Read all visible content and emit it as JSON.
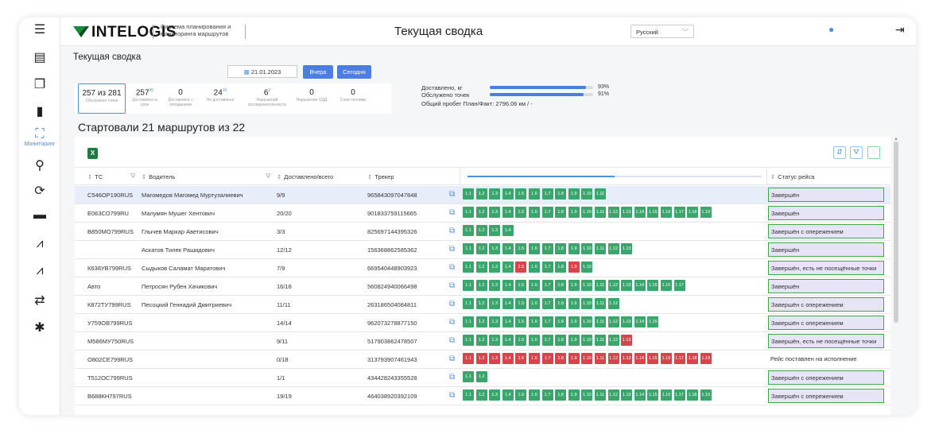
{
  "sidebar": {
    "items": [
      {
        "name": "menu-icon",
        "glyph": "☰"
      },
      {
        "name": "clipboard-icon",
        "glyph": "▤"
      },
      {
        "name": "documents-icon",
        "glyph": "❐"
      },
      {
        "name": "document-icon",
        "glyph": "▮"
      },
      {
        "name": "monitoring-icon",
        "glyph": "⛶",
        "label": "Мониторинг"
      },
      {
        "name": "routes-icon",
        "glyph": "⚲"
      },
      {
        "name": "sync-icon",
        "glyph": "⟳"
      },
      {
        "name": "folder-icon",
        "glyph": "▬"
      },
      {
        "name": "chart-icon",
        "glyph": "⩘"
      },
      {
        "name": "chart2-icon",
        "glyph": "⩘"
      },
      {
        "name": "transfer-icon",
        "glyph": "⇄"
      },
      {
        "name": "settings-icon",
        "glyph": "✱"
      }
    ]
  },
  "header": {
    "logo": "INTELOGIS",
    "logo_subtitle": "Система планирования и мониторинга маршрутов",
    "title": "Текущая сводка",
    "language": "Русский",
    "user_icon": "user-icon",
    "logout_icon": "logout-icon"
  },
  "summary": {
    "title": "Текущая сводка",
    "date": "21.01.2023",
    "btn_yesterday": "Вчера",
    "btn_today": "Сегодня",
    "stats": [
      {
        "value": "257 из 281",
        "sup": "",
        "label": "Обслужено точек"
      },
      {
        "value": "257",
        "sup": "95",
        "label": "Доставлено в срок"
      },
      {
        "value": "0",
        "sup": "",
        "label": "Доставлено с опозданием"
      },
      {
        "value": "24",
        "sup": "10",
        "label": "Не доставлено"
      },
      {
        "value": "6",
        "sup": "2",
        "label": "Нарушений последовательности"
      },
      {
        "value": "0",
        "sup": "",
        "label": "Нарушение ОДД"
      },
      {
        "value": "0",
        "sup": "",
        "label": "Слив топлива"
      }
    ],
    "progress": [
      {
        "label": "Доставлено, кг",
        "value": 93,
        "text": "93%"
      },
      {
        "label": "Обслужено точек",
        "value": 91,
        "text": "91%"
      }
    ],
    "mileage": "Общий пробег План/Факт: 2796.06 км / -"
  },
  "routes": {
    "started": "Стартовали 21 маршрутов из 22",
    "columns": {
      "tc": "ТС",
      "driver": "Водитель",
      "delivered": "Доставлено/всего",
      "tracker": "Трекер",
      "status": "Статус рейса"
    },
    "rows": [
      {
        "tc": "С546ОР190RUS",
        "driver": "Магомедов Магомед Муртузалиевич",
        "delivered": "9/9",
        "tracker": "965843097047848",
        "status": "Завершён",
        "pills": "ggggggggggg"
      },
      {
        "tc": "Е063СО799RU",
        "driver": "Малумян Мушег Хентович",
        "delivered": "20/20",
        "tracker": "901833759115665",
        "status": "Завершён",
        "pills": "ggggggggggggggggggg"
      },
      {
        "tc": "В850МО799RUS",
        "driver": "Глычев Маркар Аветисович",
        "delivered": "3/3",
        "tracker": "825697144395326",
        "status": "Завершён с опережением",
        "pills": "gggg"
      },
      {
        "tc": "",
        "driver": "Аскатов Тилек Рашидович",
        "delivered": "12/12",
        "tracker": "156368862585362",
        "status": "Завершён",
        "pills": "ggggggggggggg"
      },
      {
        "tc": "К638УВ799RUS",
        "driver": "Сыдыков Саламат Маратович",
        "delivered": "7/9",
        "tracker": "669540448903923",
        "status": "Завершён, есть не посещённые точки",
        "pills": "ggggrgggrg"
      },
      {
        "tc": "Авто",
        "driver": "Петросян Рубен Хачикович",
        "delivered": "16/16",
        "tracker": "560824940066498",
        "status": "Завершён",
        "pills": "ggggggggggggggggg"
      },
      {
        "tc": "К872ТУ799RUS",
        "driver": "Песоцкий Геннадий Дмитриевич",
        "delivered": "11/11",
        "tracker": "263186504084811",
        "status": "Завершён с опережением",
        "pills": "gggggggggggg"
      },
      {
        "tc": "У759ОВ799RUS",
        "driver": "",
        "delivered": "14/14",
        "tracker": "962073278877150",
        "status": "Завершён с опережением",
        "pills": "ggggggggggggggg"
      },
      {
        "tc": "М586МУ750RUS",
        "driver": "",
        "delivered": "9/11",
        "tracker": "517903862478507",
        "status": "Завершён, есть не посещённые точки",
        "pills": "ggggggggggggr"
      },
      {
        "tc": "О802СЕ799RUS",
        "driver": "",
        "delivered": "0/18",
        "tracker": "313793907461943",
        "status": "Рейс поставлен на исполнение",
        "pills": "rrrrrrrrrrrrrrrrrrr"
      },
      {
        "tc": "Т512ОС799RUS",
        "driver": "",
        "delivered": "1/1",
        "tracker": "434428243355528",
        "status": "Завершён с опережением",
        "pills": "gg"
      },
      {
        "tc": "В688КН797RUS",
        "driver": "",
        "delivered": "19/19",
        "tracker": "464038920392109",
        "status": "Завершён с опережением",
        "pills": "ggggggggggggggggggg"
      }
    ],
    "pill_labels": [
      "1.1",
      "1.2",
      "1.3",
      "1.4",
      "1.5",
      "1.6",
      "1.7",
      "1.8",
      "1.9",
      "1.10",
      "1.11",
      "1.12",
      "1.13",
      "1.14",
      "1.15",
      "1.16",
      "1.17",
      "1.18",
      "1.19"
    ]
  }
}
